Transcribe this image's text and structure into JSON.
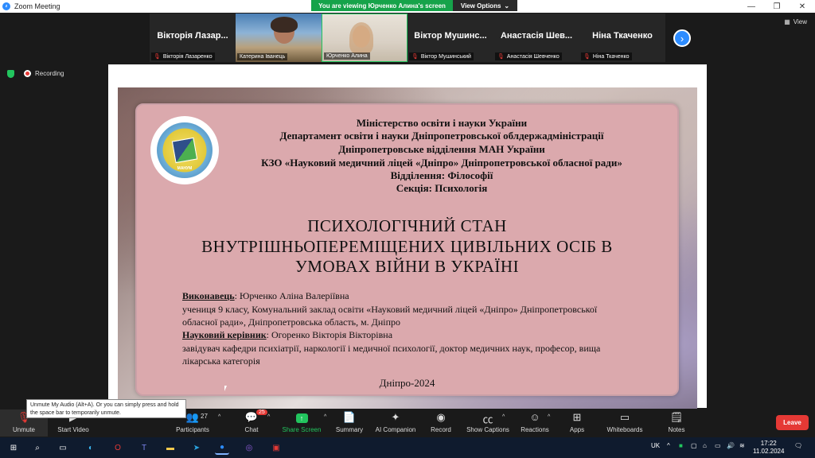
{
  "window": {
    "title": "Zoom Meeting",
    "controls": [
      "—",
      "❐",
      "✕"
    ]
  },
  "banner": {
    "message": "You are viewing Юрченко Алина's screen",
    "options": "View Options"
  },
  "gallery": {
    "tiles": [
      {
        "big_name": "Вікторія Лазар...",
        "name": "Вікторія Лазаренко"
      },
      {
        "big_name": "",
        "name": "Катерина Іванець"
      },
      {
        "big_name": "",
        "name": "Юрченко Алина"
      },
      {
        "big_name": "Віктор Мушинс...",
        "name": "Віктор Мушинський"
      },
      {
        "big_name": "Анастасія Шев...",
        "name": "Анастасія Шевченко"
      },
      {
        "big_name": "Ніна Ткаченко",
        "name": "Ніна Ткаченко"
      }
    ],
    "view_label": "View"
  },
  "recording": {
    "label": "Recording"
  },
  "slide": {
    "header_lines": [
      "Міністерство освіти і науки України",
      "Департамент освіти і науки Дніпропетровської облдержадміністрації",
      "Дніпропетровське відділення МАН України",
      "КЗО «Науковий медичний ліцей «Дніпро» Дніпропетровської обласної ради»",
      "Відділення: Філософії",
      "Секція: Психологія"
    ],
    "logo_text": "МАНУМ",
    "title_lines": [
      "ПСИХОЛОГІЧНИЙ СТАН",
      "ВНУТРІШНЬОПЕРЕМІЩЕНИХ ЦИВІЛЬНИХ ОСІБ В",
      "УМОВАХ ВІЙНИ В УКРАЇНІ"
    ],
    "author_label": "Виконавець",
    "author_name": ": Юрченко Аліна Валеріївна",
    "author_desc_1": "учениця 9 класу, Комунальний заклад освіти «Науковий медичний ліцей «Дніпро» Дніпропетровської",
    "author_desc_2": "обласної ради», Дніпропетровська область, м. Дніпро",
    "supervisor_label": "Науковий керівник",
    "supervisor_name": ":  Огоренко Вікторія Вікторівна",
    "supervisor_desc_1": "завідувач кафедри психіатрії, наркології і медичної психології, доктор медичних наук, професор, вища",
    "supervisor_desc_2": "лікарська категорія",
    "city_year": "Дніпро-2024"
  },
  "tooltip": "Unmute My Audio (Alt+A). Or you can simply press and hold the space bar to temporarily unmute.",
  "toolbar": {
    "unmute": "Unmute",
    "start_video": "Start Video",
    "participants": "Participants",
    "participants_count": "27",
    "chat": "Chat",
    "chat_badge": "25",
    "share_screen": "Share Screen",
    "summary": "Summary",
    "ai_companion": "AI Companion",
    "record": "Record",
    "show_captions": "Show Captions",
    "reactions": "Reactions",
    "apps": "Apps",
    "whiteboards": "Whiteboards",
    "notes": "Notes",
    "leave": "Leave"
  },
  "taskbar": {
    "lang": "UK",
    "time": "17:22",
    "date": "11.02.2024"
  }
}
